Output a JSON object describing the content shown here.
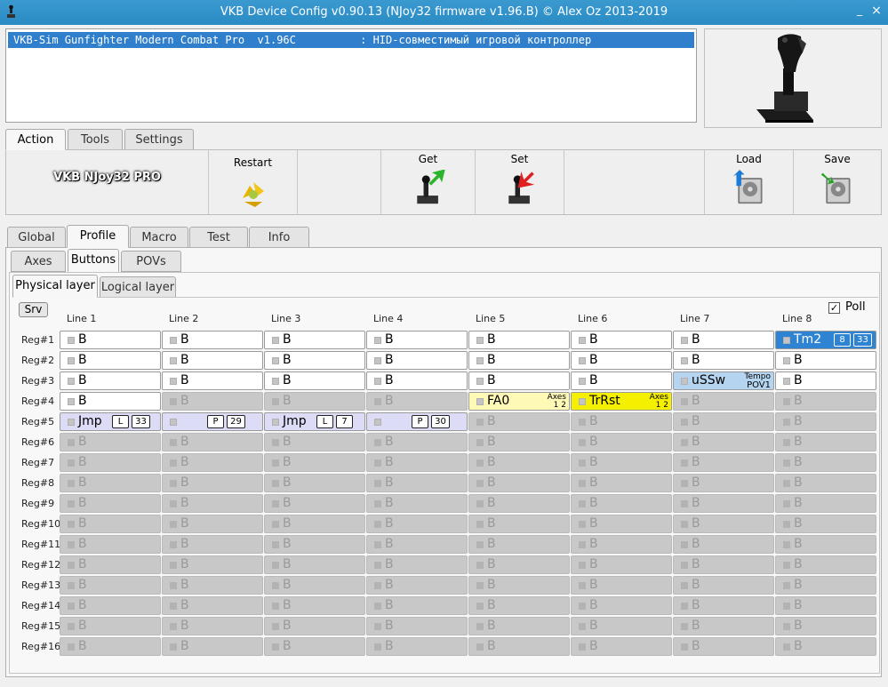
{
  "window": {
    "title": "VKB Device Config v0.90.13 (NJoy32 firmware v1.96.B) © Alex Oz 2013-2019",
    "minimize": "_",
    "close": "×"
  },
  "device_list": {
    "selected": "VKB-Sim Gunfighter Modern Combat Pro  v1.96C          : HID-совместимый игровой контроллер"
  },
  "main_tabs": [
    "Action",
    "Tools",
    "Settings"
  ],
  "toolbar": {
    "device_name": "VKB NJoy32 PRO",
    "restart": "Restart",
    "get": "Get",
    "set": "Set",
    "load": "Load",
    "save": "Save"
  },
  "section_tabs": [
    "Global",
    "Profile",
    "Macro",
    "Test",
    "Info"
  ],
  "profile_tabs": [
    "Axes",
    "Buttons",
    "POVs"
  ],
  "layer_tabs": [
    "Physical layer",
    "Logical layer"
  ],
  "srv_label": "Srv",
  "poll": {
    "label": "Poll",
    "check": "✓",
    "checked": true
  },
  "columns": [
    "Line 1",
    "Line 2",
    "Line 3",
    "Line 4",
    "Line 5",
    "Line 6",
    "Line 7",
    "Line 8"
  ],
  "rows": [
    "Reg#1",
    "Reg#2",
    "Reg#3",
    "Reg#4",
    "Reg#5",
    "Reg#6",
    "Reg#7",
    "Reg#8",
    "Reg#9",
    "Reg#10",
    "Reg#11",
    "Reg#12",
    "Reg#13",
    "Reg#14",
    "Reg#15",
    "Reg#16"
  ],
  "special_cells": {
    "r0c7": {
      "label": "Tm2",
      "box1": "8",
      "box2": "33"
    },
    "r2c6": {
      "label": "uSSw",
      "sub1": "Tempo",
      "sub2": "POV1"
    },
    "r3c4": {
      "label": "FA0",
      "sub1": "Axes",
      "sub2": "1 2"
    },
    "r3c5": {
      "label": "TrRst",
      "sub1": "Axes",
      "sub2": "1 2"
    },
    "r4c0": {
      "label": "Jmp",
      "box1": "L",
      "box2": "33"
    },
    "r4c1": {
      "label": "",
      "box1": "P",
      "box2": "29"
    },
    "r4c2": {
      "label": "Jmp",
      "box1": "L",
      "box2": "7"
    },
    "r4c3": {
      "label": "",
      "box1": "P",
      "box2": "30"
    }
  },
  "default_label": "B",
  "colors": {
    "titlebar": "#2a8ac3",
    "selected_row": "#2f7fcc",
    "tm2": "#2e84d2",
    "fa0": "#fff9b8",
    "trrst": "#f5f000",
    "ussw": "#b5d4ef",
    "jmp": "#dcdcf7",
    "disabled": "#c8c8c8"
  }
}
